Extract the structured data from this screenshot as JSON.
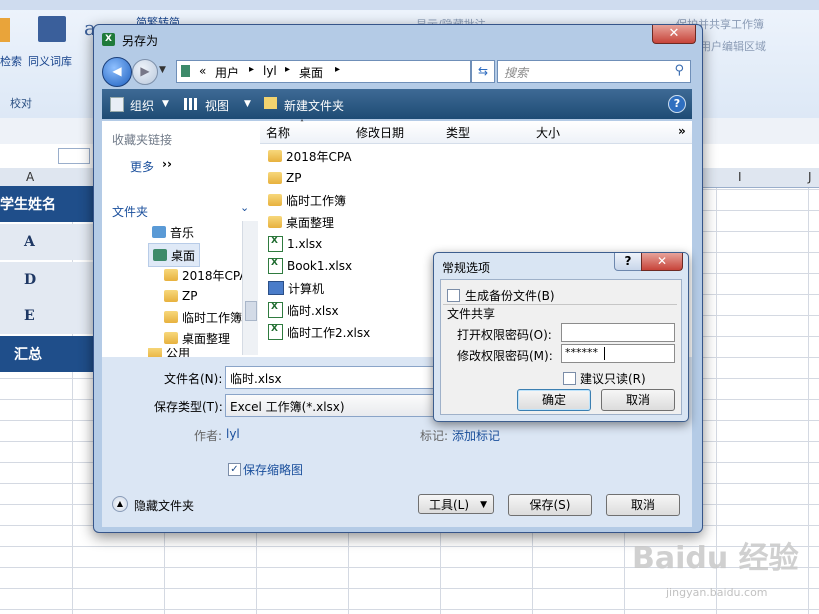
{
  "ribbon": {
    "btn_search": "检索",
    "btn_thesaurus": "同义词库",
    "group_proof": "校对",
    "btn_traditional": "简繁转简",
    "btn_protect_share": "保护并共享工作簿",
    "btn_allow_edit": "用户编辑区域",
    "btn_show_comments": "显示/隐藏批注"
  },
  "sheet": {
    "col_a": "A",
    "col_i": "I",
    "col_j": "J",
    "cell_header": "学生姓名",
    "cell_a": "A",
    "cell_d": "D",
    "cell_e": "E",
    "cell_total": "汇总"
  },
  "save_dialog": {
    "title": "另存为",
    "close": "✕",
    "address_parts": [
      "«",
      "用户",
      "lyl",
      "桌面"
    ],
    "search_placeholder": "搜索",
    "toolbar": {
      "organize": "组织",
      "views": "视图",
      "new_folder": "新建文件夹",
      "help": "?"
    },
    "nav": {
      "favorites": "收藏夹链接",
      "more": "更多",
      "folders": "文件夹",
      "tree": [
        "音乐",
        "桌面",
        "2018年CPA",
        "ZP",
        "临时工作簿",
        "桌面整理",
        "公用"
      ]
    },
    "columns": [
      "名称",
      "修改日期",
      "类型",
      "大小"
    ],
    "files": [
      {
        "name": "2018年CPA",
        "kind": "folder"
      },
      {
        "name": "ZP",
        "kind": "folder"
      },
      {
        "name": "临时工作簿",
        "kind": "folder"
      },
      {
        "name": "桌面整理",
        "kind": "folder"
      },
      {
        "name": "1.xlsx",
        "kind": "xlsx"
      },
      {
        "name": "Book1.xlsx",
        "kind": "xlsx"
      },
      {
        "name": "计算机",
        "kind": "pc"
      },
      {
        "name": "临时.xlsx",
        "kind": "xlsx"
      },
      {
        "name": "临时工作2.xlsx",
        "kind": "xlsx"
      }
    ],
    "filename_label": "文件名(N):",
    "filename_value": "临时.xlsx",
    "type_label": "保存类型(T):",
    "type_value": "Excel 工作簿(*.xlsx)",
    "author_label": "作者:",
    "author_value": "lyl",
    "tags_label": "标记:",
    "tags_value": "添加标记",
    "thumbnail_label": "保存缩略图",
    "hide_folders": "隐藏文件夹",
    "tools_button": "工具(L)",
    "save_button": "保存(S)",
    "cancel_button": "取消"
  },
  "options_dialog": {
    "title": "常规选项",
    "help": "?",
    "close": "✕",
    "backup_label": "生成备份文件(B)",
    "sharing_group": "文件共享",
    "open_pw_label": "打开权限密码(O):",
    "open_pw_value": "",
    "modify_pw_label": "修改权限密码(M):",
    "modify_pw_value": "******",
    "readonly_label": "建议只读(R)",
    "ok_button": "确定",
    "cancel_button": "取消"
  },
  "watermark": {
    "brand": "Baidu 经验",
    "url": "jingyan.baidu.com"
  }
}
